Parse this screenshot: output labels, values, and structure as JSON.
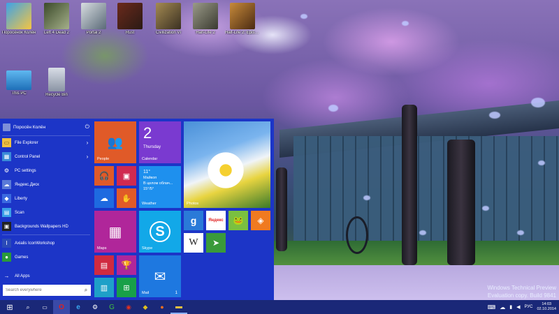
{
  "desktop": {
    "icons": [
      {
        "label": "Поросёнок Колён"
      },
      {
        "label": "Left 4 Dead 2"
      },
      {
        "label": "Portal 2"
      },
      {
        "label": "Rust"
      },
      {
        "label": "Civilization VI"
      },
      {
        "label": "Half-Life 2"
      },
      {
        "label": "Half-Life 2: Episode"
      },
      {
        "label": "This PC"
      },
      {
        "label": "Recycle Bin"
      }
    ],
    "watermark_line1": "Windows Technical Preview",
    "watermark_line2": "Evaluation copy. Build 9841"
  },
  "start_menu": {
    "user_name": "Поросён Колён",
    "items": [
      {
        "label": "File Explorer",
        "icon": "folder-icon"
      },
      {
        "label": "Control Panel",
        "icon": "control-panel-icon"
      },
      {
        "label": "PC settings",
        "icon": "gear-icon"
      },
      {
        "label": "Яндекс.Диск",
        "icon": "cloud-icon"
      },
      {
        "label": "Liberty",
        "icon": "app-icon"
      },
      {
        "label": "Scan",
        "icon": "scan-icon"
      },
      {
        "label": "Backgrounds Wallpapers HD",
        "icon": "wallpaper-icon"
      },
      {
        "label": "Axialis IconWorkshop",
        "icon": "iconworkshop-icon"
      },
      {
        "label": "Games",
        "icon": "xbox-icon"
      }
    ],
    "all_apps": "All Apps",
    "search_placeholder": "Search everywhere",
    "tiles": {
      "people": "People",
      "calendar_day": "2",
      "calendar_weekday": "Thursday",
      "calendar_label": "Calendar",
      "photos": "Photos",
      "weather_temp": "11°",
      "weather_city": "Майкоп",
      "weather_desc": "В целом облач...",
      "weather_range": "15°/5°",
      "weather_label": "Weather",
      "maps": "Maps",
      "skype": "Skype",
      "mail": "Mail",
      "mail_count": "1",
      "yandex": "Яндекс"
    }
  },
  "taskbar": {
    "language": "РУС",
    "time": "14:03",
    "date": "02.10.2014"
  }
}
